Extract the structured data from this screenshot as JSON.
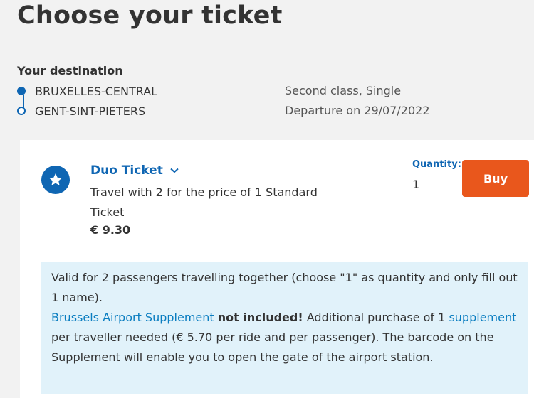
{
  "page": {
    "title": "Choose your ticket"
  },
  "destination": {
    "label": "Your destination",
    "from": "BRUXELLES-CENTRAL",
    "to": "GENT-SINT-PIETERS",
    "travel_class": "Second class, Single",
    "departure": "Departure on 29/07/2022"
  },
  "ticket": {
    "name": "Duo Ticket",
    "description": "Travel with 2 for the price of 1 Standard Ticket",
    "price": "€ 9.30",
    "quantity_label": "Quantity:",
    "quantity_value": "1",
    "buy_label": "Buy"
  },
  "info": {
    "line1": "Valid for 2 passengers travelling together (choose \"1\" as quantity and only fill out 1 name).",
    "airport_link": "Brussels Airport Supplement",
    "not_included": "not included!",
    "purchase_text_1": " Additional purchase of 1 ",
    "supplement_link": "supplement",
    "purchase_text_2": " per traveller needed (€ 5.70 per ride and per passenger). The barcode on the Supplement will enable you to open the gate of the airport station."
  },
  "colors": {
    "primary_blue": "#0f66b3",
    "buy_orange": "#e9571c",
    "info_background": "#e1f2fa",
    "link_blue": "#0a7dc0"
  },
  "icons": {
    "badge": "star-icon",
    "expand": "chevron-down-icon"
  }
}
